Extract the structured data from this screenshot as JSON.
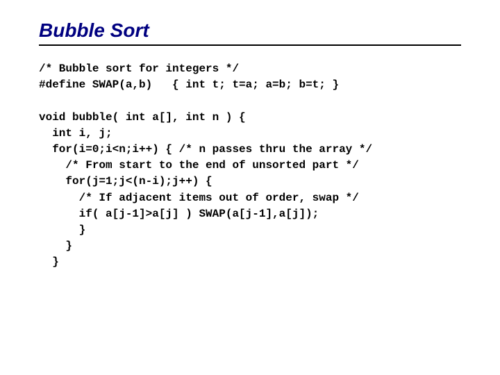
{
  "title": "Bubble Sort",
  "code": "/* Bubble sort for integers */\n#define SWAP(a,b)   { int t; t=a; a=b; b=t; }\n\nvoid bubble( int a[], int n ) {\n  int i, j;\n  for(i=0;i<n;i++) { /* n passes thru the array */\n    /* From start to the end of unsorted part */\n    for(j=1;j<(n-i);j++) {\n      /* If adjacent items out of order, swap */\n      if( a[j-1]>a[j] ) SWAP(a[j-1],a[j]);\n      }\n    }\n  }"
}
